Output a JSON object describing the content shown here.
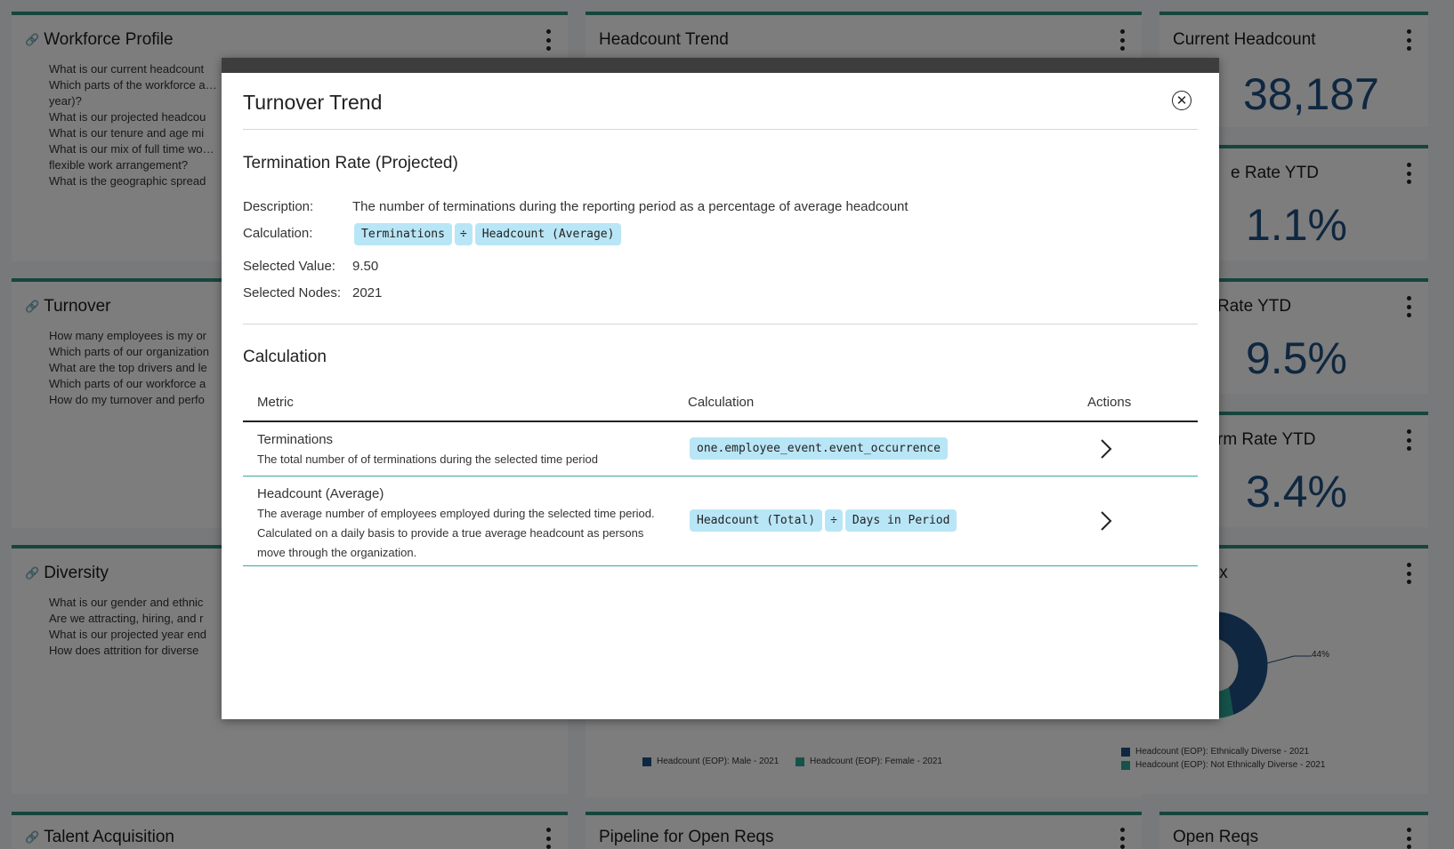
{
  "dashboard": {
    "workforce_profile": {
      "title": "Workforce Profile",
      "questions": [
        "What is our current headcount",
        "Which parts of the workforce a… year)?",
        "What is our projected headcou",
        "What is our tenure and age mi",
        "What is our mix of full time wo… flexible work arrangement?",
        "What is the geographic spread"
      ]
    },
    "headcount_trend": {
      "title": "Headcount Trend"
    },
    "current_headcount": {
      "title": "Current Headcount",
      "value": "38,187"
    },
    "stat_2": {
      "title": "e Rate YTD",
      "value": "1.1%"
    },
    "stat_3": {
      "title": "Rate YTD",
      "value": "9.5%"
    },
    "stat_4": {
      "title": "rm Rate YTD",
      "value": "3.4%"
    },
    "turnover": {
      "title": "Turnover",
      "questions": [
        "How many employees is my or",
        "Which parts of our organization",
        "What are the top drivers and le",
        "Which parts of our workforce a",
        "How do my turnover and perfo"
      ]
    },
    "diversity": {
      "title": "Diversity",
      "questions": [
        "What is our gender and ethnic",
        "Are we attracting, hiring, and r",
        "What is our projected year end",
        "How does attrition for diverse"
      ]
    },
    "mix": {
      "title": "ix",
      "pct_label": "44%",
      "legend": [
        "Headcount (EOP): Ethnically Diverse - 2021",
        "Headcount (EOP): Not Ethnically Diverse - 2021"
      ]
    },
    "gender_legend": [
      "Headcount (EOP): Male - 2021",
      "Headcount (EOP): Female - 2021"
    ],
    "talent_acquisition": {
      "title": "Talent Acquisition"
    },
    "pipeline": {
      "title": "Pipeline for Open Reqs"
    },
    "open_reqs": {
      "title": "Open Reqs"
    },
    "colors": {
      "accent": "#2e8b7a",
      "dark_blue": "#1f4e80",
      "teal": "#2aa594"
    }
  },
  "modal": {
    "title": "Turnover Trend",
    "metric_title": "Termination Rate (Projected)",
    "labels": {
      "description": "Description:",
      "calculation": "Calculation:",
      "selected_value": "Selected Value:",
      "selected_nodes": "Selected Nodes:"
    },
    "description": "The number of terminations during the reporting period as a percentage of average headcount",
    "calculation_chips": [
      "Terminations",
      "÷",
      "Headcount (Average)"
    ],
    "selected_value": "9.50",
    "selected_nodes": "2021",
    "calc_section_title": "Calculation",
    "table": {
      "headers": [
        "Metric",
        "Calculation",
        "Actions"
      ],
      "rows": [
        {
          "name": "Terminations",
          "description": "The total number of of terminations during the selected time period",
          "chips": [
            "one.employee_event.event_occurrence"
          ]
        },
        {
          "name": "Headcount (Average)",
          "description": "The average number of employees employed during the selected time period. Calculated on a daily basis to provide a true average headcount as persons move through the organization.",
          "chips": [
            "Headcount (Total)",
            "÷",
            "Days in Period"
          ]
        }
      ]
    }
  }
}
